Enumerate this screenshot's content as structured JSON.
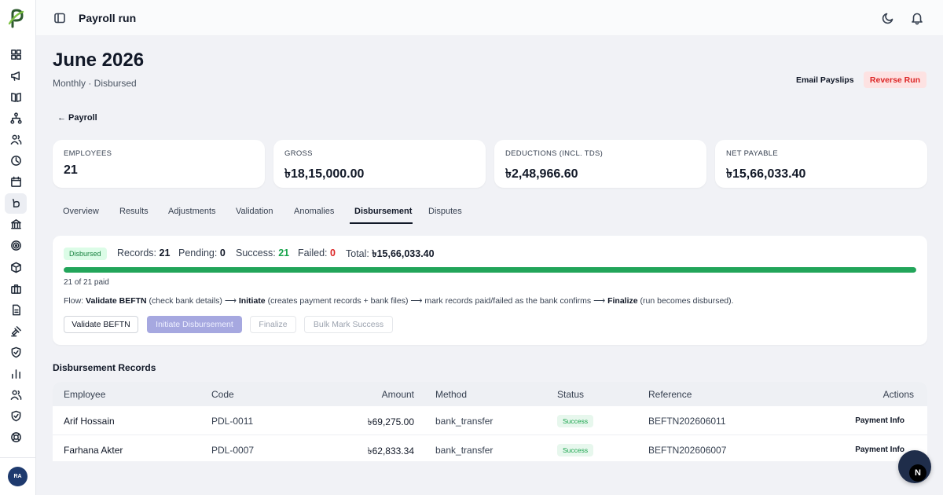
{
  "app": {
    "title": "Payroll run"
  },
  "user": {
    "initials": "RA"
  },
  "page": {
    "title": "June 2026",
    "subtitle": "Monthly · Disbursed",
    "back_label": "← Payroll",
    "email_label": "Email Payslips",
    "reverse_label": "Reverse Run"
  },
  "stats": [
    {
      "label": "EMPLOYEES",
      "value": "21"
    },
    {
      "label": "GROSS",
      "value": "৳18,15,000.00"
    },
    {
      "label": "DEDUCTIONS (INCL. TDS)",
      "value": "৳2,48,966.60"
    },
    {
      "label": "NET PAYABLE",
      "value": "৳15,66,033.40"
    }
  ],
  "tabs": [
    "Overview",
    "Results",
    "Adjustments",
    "Validation",
    "Anomalies",
    "Disbursement",
    "Disputes"
  ],
  "active_tab": "Disbursement",
  "disbursement": {
    "status": "Disbursed",
    "records_label": "Records:",
    "records": "21",
    "pending_label": "Pending:",
    "pending": "0",
    "success_label": "Success:",
    "success": "21",
    "failed_label": "Failed:",
    "failed": "0",
    "total_label": "Total:",
    "total": "৳15,66,033.40",
    "progress_fraction": 1.0,
    "paid_text": "21 of 21 paid",
    "flow": {
      "prefix": "Flow: ",
      "step1": "Validate BEFTN",
      "step1_note": " (check bank details) ⟶ ",
      "step2": "Initiate",
      "step2_note": " (creates payment records + bank files) ⟶ mark records paid/failed as the bank confirms ⟶ ",
      "step3": "Finalize",
      "step3_note": " (run becomes disbursed)."
    },
    "buttons": {
      "validate": "Validate BEFTN",
      "initiate": "Initiate Disbursement",
      "finalize": "Finalize",
      "bulk": "Bulk Mark Success"
    }
  },
  "records": {
    "title": "Disbursement Records",
    "columns": [
      "Employee",
      "Code",
      "Amount",
      "Method",
      "Status",
      "Reference",
      "Actions"
    ],
    "rows": [
      {
        "employee": "Arif Hossain",
        "code": "PDL-0011",
        "amount": "৳69,275.00",
        "method": "bank_transfer",
        "status": "Success",
        "reference": "BEFTN202606011",
        "action": "Payment Info"
      },
      {
        "employee": "Farhana Akter",
        "code": "PDL-0007",
        "amount": "৳62,833.34",
        "method": "bank_transfer",
        "status": "Success",
        "reference": "BEFTN202606007",
        "action": "Payment Info"
      }
    ]
  },
  "sidebar_icons": [
    "dashboard-icon",
    "megaphone-icon",
    "book-icon",
    "org-chart-icon",
    "users-icon",
    "clock-icon",
    "calendar-icon",
    "payroll-icon",
    "bank-icon",
    "target-icon",
    "package-icon",
    "briefcase-icon",
    "document-icon",
    "gavel-icon",
    "shield-icon",
    "bar-chart-icon",
    "team-icon",
    "shield-check-icon",
    "lifebuoy-icon"
  ],
  "fab_label": "N",
  "colors": {
    "accent": "#22a55a",
    "danger": "#dc2626",
    "primary_disabled": "#a6a8e0"
  }
}
